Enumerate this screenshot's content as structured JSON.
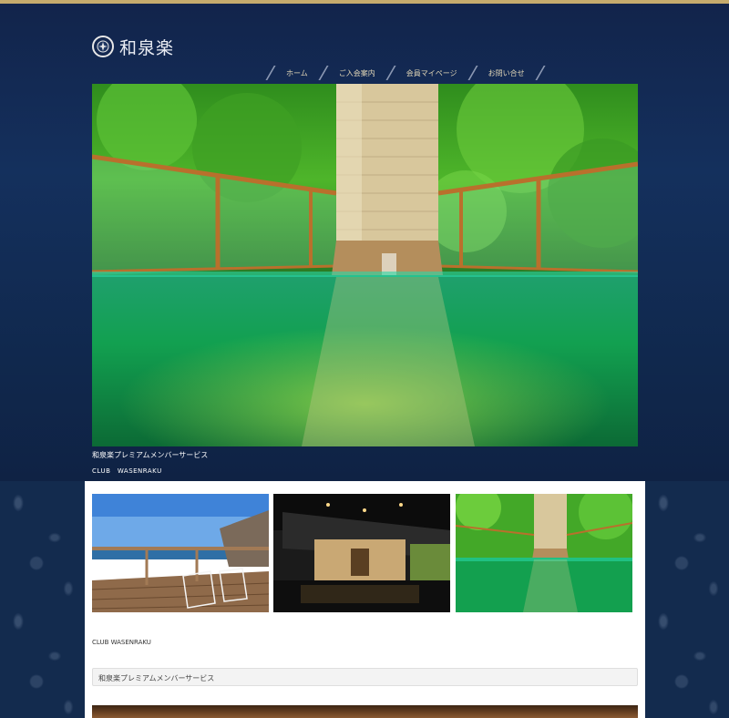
{
  "brand": {
    "logo_text": "和泉楽",
    "logo_icon": "crest-emblem-icon"
  },
  "nav": {
    "items": [
      {
        "label": "ホーム"
      },
      {
        "label": "ご入会案内"
      },
      {
        "label": "会員マイページ"
      },
      {
        "label": "お問い合せ"
      }
    ]
  },
  "hero": {
    "caption": "和泉楽プレミアムメンバーサービス",
    "sub_caption": "CLUB　WASENRAKU"
  },
  "content": {
    "club_label": "CLUB WASENRAKU",
    "info_box_text": "和泉楽プレミアムメンバーサービス"
  },
  "colors": {
    "accent_gold": "#c6ab6d",
    "navy": "#14305d",
    "nav_text": "#e2d7b7"
  }
}
